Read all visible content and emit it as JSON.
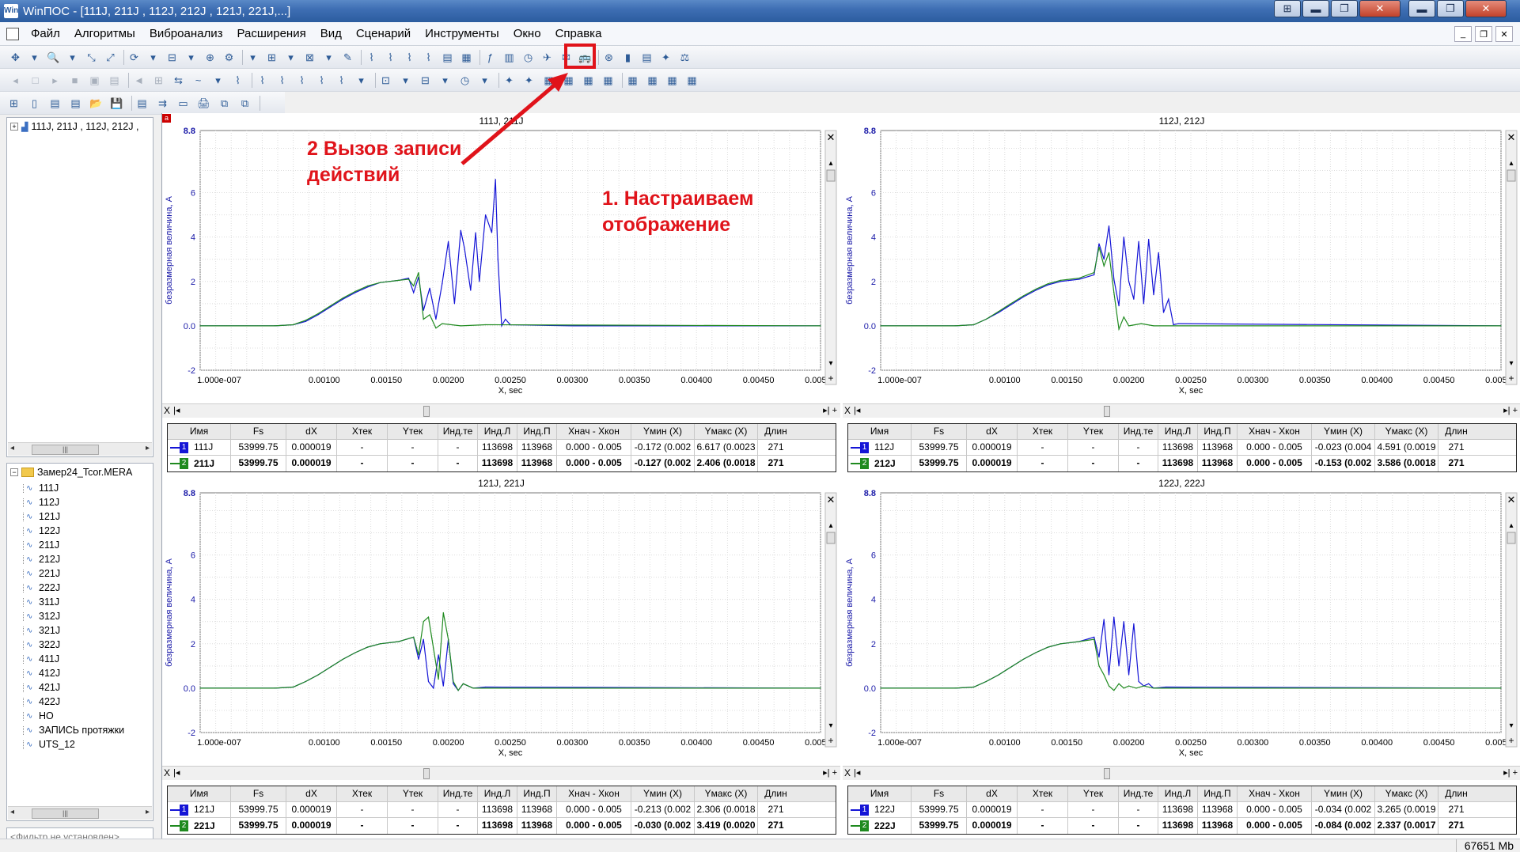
{
  "app": {
    "title": "WinПОС - [111J, 211J , 112J, 212J , 121J, 221J,...]",
    "icon_text": "Win"
  },
  "window_buttons": [
    "⊞",
    "▬",
    "❐",
    "✕"
  ],
  "menu": [
    "Файл",
    "Алгоритмы",
    "Виброанализ",
    "Расширения",
    "Вид",
    "Сценарий",
    "Инструменты",
    "Окно",
    "Справка"
  ],
  "mdi_buttons": [
    "_",
    "❐",
    "✕"
  ],
  "left_tree": {
    "top_item": "111J, 211J , 112J, 212J ,",
    "folder": "Замер24_Tcor.MERA",
    "items": [
      "111J",
      "112J",
      "121J",
      "122J",
      "211J",
      "212J",
      "221J",
      "222J",
      "311J",
      "312J",
      "321J",
      "322J",
      "411J",
      "412J",
      "421J",
      "422J",
      "HO",
      "ЗАПИСЬ протяжки",
      "UTS_12"
    ],
    "filter": "<Фильтр не установлен>"
  },
  "status": {
    "memory": "67651 Mb"
  },
  "annotations": {
    "step2_line1": "2 Вызов записи",
    "step2_line2": "действий",
    "step1_line1": "1. Настраиваем",
    "step1_line2": "отображение",
    "color": "#e0131a"
  },
  "plot_common": {
    "ylabel": "безразмерная величина, A",
    "xlabel": "X, sec",
    "x_ticks": [
      "1.000e-007",
      "0.00100",
      "0.00150",
      "0.00200",
      "0.00250",
      "0.00300",
      "0.00350",
      "0.00400",
      "0.00450",
      "0.00500"
    ],
    "y_ticks": [
      "8.8",
      "6",
      "4",
      "2",
      "0.0",
      "-2"
    ],
    "table_headers": [
      "Имя",
      "Fs",
      "dX",
      "Xтек",
      "Yтек",
      "Инд.те",
      "Инд.Л",
      "Инд.П",
      "Xнач - Xкон",
      "Yмин (X)",
      "Yмакс (X)",
      "Длин"
    ]
  },
  "chart_data": [
    {
      "type": "line",
      "title": "111J, 211J",
      "xlabel": "X, sec",
      "ylabel": "безразмерная величина, A",
      "xlim": [
        0,
        0.005
      ],
      "ylim": [
        -2,
        8.8
      ],
      "grid": true,
      "series": [
        {
          "name": "111J",
          "color": "#1515d6",
          "x": [
            0,
            0.0006,
            0.00075,
            0.00085,
            0.00095,
            0.00105,
            0.00115,
            0.00125,
            0.00135,
            0.00145,
            0.0016,
            0.00168,
            0.00172,
            0.00176,
            0.0018,
            0.00185,
            0.0019,
            0.00195,
            0.002,
            0.00205,
            0.0021,
            0.00213,
            0.00218,
            0.00222,
            0.00225,
            0.0023,
            0.00235,
            0.00238,
            0.0024,
            0.00243,
            0.00246,
            0.0025,
            0.003,
            0.005
          ],
          "y": [
            0,
            0,
            0.05,
            0.2,
            0.5,
            0.85,
            1.2,
            1.5,
            1.75,
            1.95,
            2.05,
            2.15,
            1.5,
            2.2,
            0.7,
            1.7,
            0.3,
            1.9,
            3.8,
            1.0,
            4.3,
            3.5,
            1.6,
            4.2,
            2.0,
            5.0,
            4.2,
            6.6,
            3.0,
            0.0,
            0.3,
            0.05,
            0,
            0
          ]
        },
        {
          "name": "211J",
          "color": "#1f8a1f",
          "x": [
            0,
            0.0006,
            0.00075,
            0.00085,
            0.00095,
            0.00105,
            0.00115,
            0.00125,
            0.00135,
            0.00145,
            0.0016,
            0.00168,
            0.00172,
            0.00176,
            0.0018,
            0.00185,
            0.0019,
            0.00195,
            0.0021,
            0.0023,
            0.005
          ],
          "y": [
            0,
            0,
            0.05,
            0.25,
            0.55,
            0.9,
            1.25,
            1.55,
            1.8,
            1.95,
            2.05,
            2.1,
            1.8,
            2.4,
            0.3,
            0.5,
            -0.1,
            0.1,
            0.0,
            0.05,
            0
          ]
        }
      ]
    },
    {
      "type": "line",
      "title": "112J, 212J",
      "xlabel": "X, sec",
      "ylabel": "безразмерная величина, A",
      "xlim": [
        0,
        0.005
      ],
      "ylim": [
        -2,
        8.8
      ],
      "grid": true,
      "series": [
        {
          "name": "112J",
          "color": "#1515d6",
          "x": [
            0,
            0.0006,
            0.00075,
            0.00085,
            0.00095,
            0.00105,
            0.00115,
            0.00125,
            0.00135,
            0.00145,
            0.0016,
            0.00172,
            0.00176,
            0.0018,
            0.00184,
            0.00188,
            0.00192,
            0.00196,
            0.002,
            0.00204,
            0.00208,
            0.00212,
            0.00216,
            0.0022,
            0.00224,
            0.00228,
            0.00232,
            0.00236,
            0.0024,
            0.005
          ],
          "y": [
            0,
            0,
            0.05,
            0.3,
            0.6,
            0.95,
            1.3,
            1.6,
            1.85,
            2.0,
            2.1,
            2.3,
            3.7,
            3.0,
            4.5,
            2.1,
            0.9,
            4.0,
            2.0,
            1.2,
            3.8,
            1.0,
            3.9,
            1.4,
            3.3,
            0.6,
            1.2,
            0.05,
            0.1,
            0
          ]
        },
        {
          "name": "212J",
          "color": "#1f8a1f",
          "x": [
            0,
            0.0006,
            0.00075,
            0.00085,
            0.00095,
            0.00105,
            0.00115,
            0.00125,
            0.00135,
            0.00145,
            0.0016,
            0.00172,
            0.00176,
            0.0018,
            0.00184,
            0.00188,
            0.00192,
            0.00196,
            0.002,
            0.0021,
            0.0022,
            0.005
          ],
          "y": [
            0,
            0,
            0.05,
            0.3,
            0.65,
            1.0,
            1.35,
            1.65,
            1.9,
            2.05,
            2.15,
            2.4,
            3.55,
            2.7,
            3.3,
            1.5,
            -0.15,
            0.4,
            0.0,
            0.1,
            0.0,
            0
          ]
        }
      ]
    },
    {
      "type": "line",
      "title": "121J, 221J",
      "xlabel": "X, sec",
      "ylabel": "безразмерная величина, A",
      "xlim": [
        0,
        0.005
      ],
      "ylim": [
        -2,
        8.8
      ],
      "grid": true,
      "series": [
        {
          "name": "121J",
          "color": "#1515d6",
          "x": [
            0,
            0.0006,
            0.00075,
            0.00085,
            0.00095,
            0.00105,
            0.00115,
            0.00125,
            0.00135,
            0.00145,
            0.0016,
            0.00172,
            0.00176,
            0.0018,
            0.00184,
            0.00188,
            0.00192,
            0.00196,
            0.002,
            0.00204,
            0.00208,
            0.00212,
            0.0022,
            0.0023,
            0.005
          ],
          "y": [
            0,
            0,
            0.05,
            0.3,
            0.6,
            0.95,
            1.3,
            1.6,
            1.85,
            2.0,
            2.1,
            2.3,
            1.3,
            2.2,
            0.3,
            0.0,
            1.5,
            0.1,
            2.2,
            0.2,
            -0.1,
            0.2,
            0.0,
            0.05,
            0
          ]
        },
        {
          "name": "221J",
          "color": "#1f8a1f",
          "x": [
            0,
            0.0006,
            0.00075,
            0.00085,
            0.00095,
            0.00105,
            0.00115,
            0.00125,
            0.00135,
            0.00145,
            0.0016,
            0.00172,
            0.00176,
            0.0018,
            0.00184,
            0.00188,
            0.00192,
            0.00196,
            0.002,
            0.00204,
            0.00208,
            0.00212,
            0.0022,
            0.005
          ],
          "y": [
            0,
            0,
            0.05,
            0.3,
            0.6,
            0.95,
            1.3,
            1.6,
            1.85,
            2.0,
            2.1,
            2.3,
            1.5,
            3.0,
            3.2,
            1.8,
            0.4,
            3.4,
            2.2,
            0.3,
            -0.1,
            0.2,
            0.0,
            0
          ]
        }
      ]
    },
    {
      "type": "line",
      "title": "122J, 222J",
      "xlabel": "X, sec",
      "ylabel": "безразмерная величина, A",
      "xlim": [
        0,
        0.005
      ],
      "ylim": [
        -2,
        8.8
      ],
      "grid": true,
      "series": [
        {
          "name": "122J",
          "color": "#1515d6",
          "x": [
            0,
            0.0006,
            0.00075,
            0.00085,
            0.00095,
            0.00105,
            0.00115,
            0.00125,
            0.00135,
            0.00145,
            0.0016,
            0.00172,
            0.00176,
            0.0018,
            0.00184,
            0.00188,
            0.00192,
            0.00196,
            0.002,
            0.00204,
            0.00208,
            0.00212,
            0.00216,
            0.0022,
            0.0023,
            0.005
          ],
          "y": [
            0,
            0,
            0.05,
            0.3,
            0.6,
            0.95,
            1.3,
            1.6,
            1.85,
            2.0,
            2.1,
            2.3,
            1.4,
            3.1,
            0.6,
            3.2,
            1.0,
            3.0,
            0.6,
            2.9,
            0.3,
            0.1,
            0.2,
            0.0,
            0.05,
            0
          ]
        },
        {
          "name": "222J",
          "color": "#1f8a1f",
          "x": [
            0,
            0.0006,
            0.00075,
            0.00085,
            0.00095,
            0.00105,
            0.00115,
            0.00125,
            0.00135,
            0.00145,
            0.0016,
            0.00172,
            0.00176,
            0.0018,
            0.00184,
            0.00188,
            0.00192,
            0.00196,
            0.002,
            0.00206,
            0.00212,
            0.0022,
            0.005
          ],
          "y": [
            0,
            0,
            0.05,
            0.3,
            0.6,
            0.95,
            1.3,
            1.6,
            1.85,
            2.0,
            2.1,
            2.2,
            1.0,
            0.6,
            0.1,
            -0.1,
            0.2,
            0.0,
            0.1,
            0.0,
            0.1,
            0.0,
            0
          ]
        }
      ]
    }
  ],
  "panels": [
    {
      "title": "111J, 211J",
      "rows": [
        {
          "idx": "1",
          "color": "#1515d6",
          "bold": false,
          "cells": [
            "111J",
            "53999.75",
            "0.000019",
            "-",
            "-",
            "-",
            "113698",
            "113968",
            "0.000 - 0.005",
            "-0.172 (0.002",
            "6.617 (0.0023",
            "271"
          ]
        },
        {
          "idx": "2",
          "color": "#1f8a1f",
          "bold": true,
          "cells": [
            "211J",
            "53999.75",
            "0.000019",
            "-",
            "-",
            "-",
            "113698",
            "113968",
            "0.000 - 0.005",
            "-0.127 (0.002",
            "2.406 (0.0018",
            "271"
          ]
        }
      ]
    },
    {
      "title": "112J, 212J",
      "rows": [
        {
          "idx": "1",
          "color": "#1515d6",
          "bold": false,
          "cells": [
            "112J",
            "53999.75",
            "0.000019",
            "-",
            "-",
            "-",
            "113698",
            "113968",
            "0.000 - 0.005",
            "-0.023 (0.004",
            "4.591 (0.0019",
            "271"
          ]
        },
        {
          "idx": "2",
          "color": "#1f8a1f",
          "bold": true,
          "cells": [
            "212J",
            "53999.75",
            "0.000019",
            "-",
            "-",
            "-",
            "113698",
            "113968",
            "0.000 - 0.005",
            "-0.153 (0.002",
            "3.586 (0.0018",
            "271"
          ]
        }
      ]
    },
    {
      "title": "121J, 221J",
      "rows": [
        {
          "idx": "1",
          "color": "#1515d6",
          "bold": false,
          "cells": [
            "121J",
            "53999.75",
            "0.000019",
            "-",
            "-",
            "-",
            "113698",
            "113968",
            "0.000 - 0.005",
            "-0.213 (0.002",
            "2.306 (0.0018",
            "271"
          ]
        },
        {
          "idx": "2",
          "color": "#1f8a1f",
          "bold": true,
          "cells": [
            "221J",
            "53999.75",
            "0.000019",
            "-",
            "-",
            "-",
            "113698",
            "113968",
            "0.000 - 0.005",
            "-0.030 (0.002",
            "3.419 (0.0020",
            "271"
          ]
        }
      ]
    },
    {
      "title": "122J, 222J",
      "rows": [
        {
          "idx": "1",
          "color": "#1515d6",
          "bold": false,
          "cells": [
            "122J",
            "53999.75",
            "0.000019",
            "-",
            "-",
            "-",
            "113698",
            "113968",
            "0.000 - 0.005",
            "-0.034 (0.002",
            "3.265 (0.0019",
            "271"
          ]
        },
        {
          "idx": "2",
          "color": "#1f8a1f",
          "bold": true,
          "cells": [
            "222J",
            "53999.75",
            "0.000019",
            "-",
            "-",
            "-",
            "113698",
            "113968",
            "0.000 - 0.005",
            "-0.084 (0.002",
            "2.337 (0.0017",
            "271"
          ]
        }
      ]
    }
  ]
}
